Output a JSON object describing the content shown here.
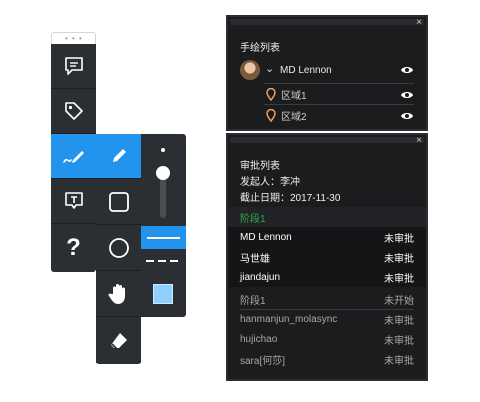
{
  "toolbar": {
    "tools": [
      {
        "name": "comment",
        "icon": "chat-icon"
      },
      {
        "name": "tag",
        "icon": "tag-icon"
      },
      {
        "name": "draw",
        "icon": "pen-scribble-icon",
        "active": true
      },
      {
        "name": "text",
        "icon": "text-box-icon"
      },
      {
        "name": "help",
        "icon": "question-icon",
        "glyph": "?"
      }
    ],
    "draw_sub": [
      "pen-icon",
      "rectangle-icon",
      "circle-icon",
      "hand-icon",
      "eraser-icon"
    ],
    "style_sub": {
      "slider_level": 0.35,
      "line_solid_color": "#ffffff",
      "fill_color": "#8fd0ff"
    }
  },
  "draw_list": {
    "title": "手绘列表",
    "close": "×",
    "user": {
      "name": "MD Lennon"
    },
    "areas": [
      "区域1",
      "区域2"
    ]
  },
  "approval": {
    "title": "审批列表",
    "close": "×",
    "initiator": "发起人：李冲",
    "deadline": "截止日期：2017-11-30",
    "stages": [
      {
        "label": "阶段1",
        "active": true,
        "status": "",
        "items": [
          {
            "name": "MD Lennon",
            "status": "未审批"
          },
          {
            "name": "马世雄",
            "status": "未审批"
          },
          {
            "name": "jiandajun",
            "status": "未审批"
          }
        ]
      },
      {
        "label": "阶段1",
        "active": false,
        "status": "未开始",
        "items": [
          {
            "name": "hanmanjun_molasync",
            "status": "未审批"
          },
          {
            "name": "hujichao",
            "status": "未审批"
          },
          {
            "name": "sara[何莎]",
            "status": "未审批"
          }
        ]
      }
    ]
  },
  "colors": {
    "accent": "#2294ee",
    "panel": "#1b1c1e",
    "toolbar": "#2b2e32",
    "stage_active": "#2fa94a"
  }
}
